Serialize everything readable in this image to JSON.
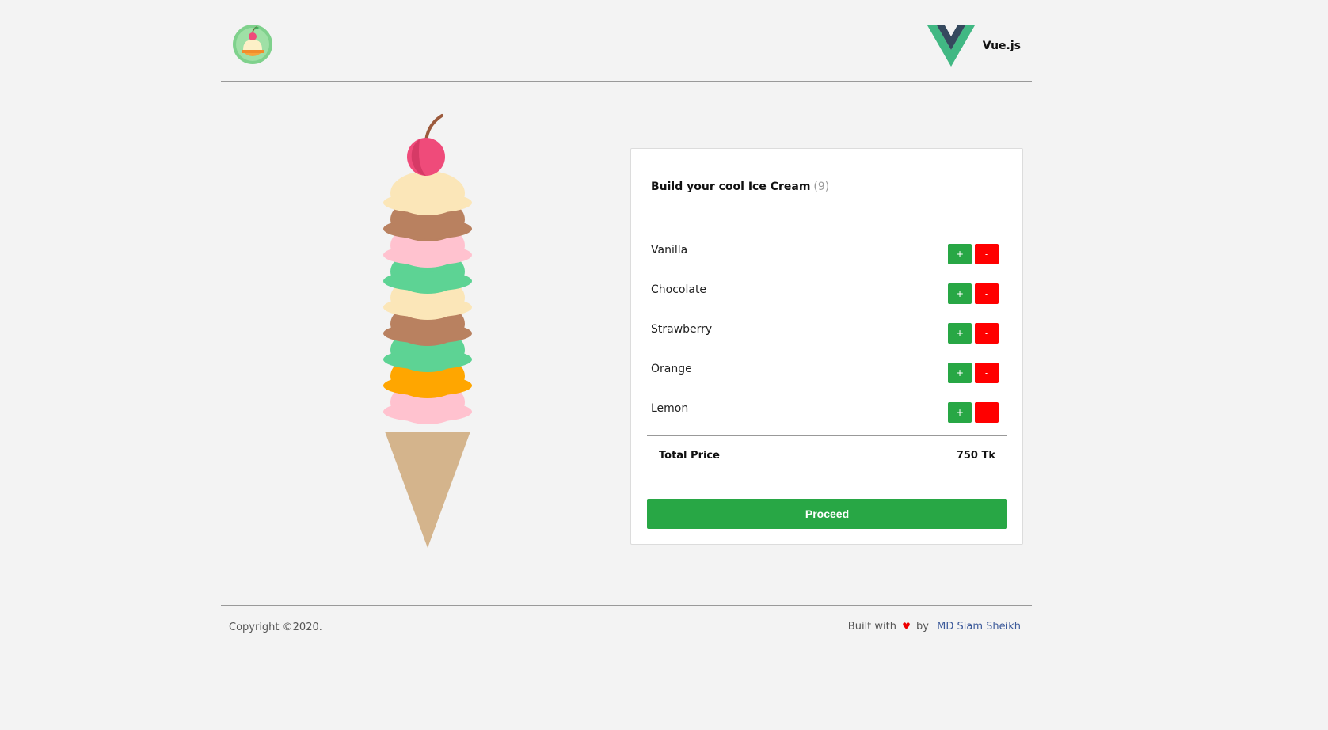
{
  "header": {
    "logo_icon": "ice-cream-logo-icon",
    "brand_icon": "vue-logo-icon",
    "brand_label": "Vue.js"
  },
  "illustration": {
    "icon": "ice-cream-cone-illustration",
    "scoop_colors_top_to_bottom": [
      "#fbe6b8",
      "#b98160",
      "#ffc2cf",
      "#5dd394",
      "#fbe6b8",
      "#b98160",
      "#5dd394",
      "#ffa600",
      "#ffc2cf"
    ],
    "cone_color": "#d4b48c",
    "cherry_color": "#ef4b7a"
  },
  "builder": {
    "title": "Build your cool Ice Cream",
    "count": "(9)",
    "plus_label": "+",
    "minus_label": "-",
    "flavors": [
      {
        "name": "Vanilla"
      },
      {
        "name": "Chocolate"
      },
      {
        "name": "Strawberry"
      },
      {
        "name": "Orange"
      },
      {
        "name": "Lemon"
      }
    ],
    "total_label": "Total Price",
    "total_value": "750 Tk",
    "proceed_label": "Proceed"
  },
  "footer": {
    "copyright": "Copyright ©2020.",
    "built_with": "Built with",
    "by": "by",
    "author": "MD Siam Sheikh",
    "heart_icon": "heart-icon"
  },
  "colors": {
    "background": "#f3f3f3",
    "plus_button": "#28a745",
    "minus_button": "#ff0000",
    "proceed_button": "#28a745",
    "link": "#3c5a9a"
  }
}
